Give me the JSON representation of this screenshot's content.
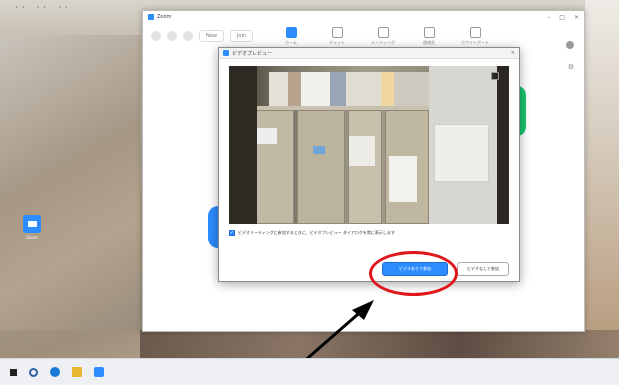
{
  "desktop": {
    "top_files": [
      "・ ・",
      "・ ・",
      "・ ・"
    ],
    "icon_label": "Zoom"
  },
  "app": {
    "title": "Zoom",
    "window_buttons": [
      "–",
      "□",
      "×"
    ],
    "toolbar_pills": [
      "New",
      "Join"
    ],
    "nav": [
      {
        "label": "ホーム",
        "active": true
      },
      {
        "label": "チャット",
        "active": false
      },
      {
        "label": "ミーティング",
        "active": false
      },
      {
        "label": "連絡先",
        "active": false
      },
      {
        "label": "ホワイトボード",
        "active": false
      }
    ]
  },
  "dialog": {
    "title": "ビデオプレビュー",
    "close": "×",
    "checkbox_label": "ビデオミーティングに参加するときに、ビデオプレビュー ダイアログを常に表示します",
    "checkbox_checked": true,
    "join_with_video_label": "ビデオありで参加",
    "join_without_video_label": "ビデオなしで参加"
  },
  "taskbar": {
    "items": [
      "start-icon",
      "search-icon",
      "browser-icon",
      "folder-icon",
      "zoom-icon"
    ]
  },
  "colors": {
    "accent": "#2d8cff",
    "annotation": "#e0161b"
  }
}
